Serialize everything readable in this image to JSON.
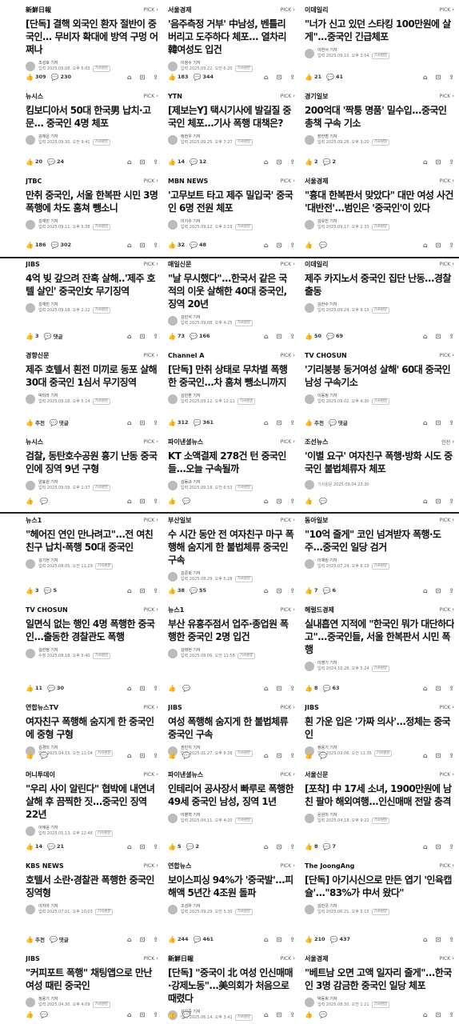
{
  "cards": [
    {
      "press": "新鮮日報",
      "pick": "PICK",
      "title": "[단독] 결핵 외국인 환자 절반이 중국인... 무비자 확대에 방역 구멍 어쩌나",
      "author": "조성호 기자",
      "date": "입력 2025.09.08. 오후 6:03",
      "tag": "기사원문",
      "likes": "309",
      "comments": "230"
    },
    {
      "press": "서울경제",
      "pick": "PICK",
      "title": "'음주측정 거부' 中남성, 벤틀리 버리고 도주하다 체포... 열차리 韓여성도 입건",
      "author": "이정수 기자",
      "date": "입력 2025.09.22. 오전 6:20",
      "tag": "기사원문",
      "likes": "183",
      "comments": "344"
    },
    {
      "press": "이데일리",
      "pick": "PICK",
      "title": "\"너가 신고 있던 스타킹 100만원에 살게\"...중국인 긴급체포",
      "author": "이연서 기자",
      "date": "입력 2025.09.10. 오후 3:54",
      "tag": "기사원문",
      "likes": "21",
      "comments": "41"
    },
    {
      "press": "뉴시스",
      "pick": "PICK",
      "title": "킴보디아서 50대 한국男 납치·고문... 중국인 4명 체포",
      "author": "김재은 기자",
      "date": "입력 2025.09.30. 오전 9:41",
      "tag": "기사원문",
      "likes": "20",
      "comments": "24"
    },
    {
      "press": "YTN",
      "pick": "PICK",
      "title": "[제보는Y] 택시기사에 발길질 중국인 체포...기사 폭행 대책은?",
      "author": "정현우 기자",
      "date": "입력 2025.09.25. 오후 7:27",
      "tag": "기사원문",
      "likes": "14",
      "comments": "12"
    },
    {
      "press": "경기일보",
      "pick": "PICK",
      "title": "200억대 '짝퉁 명품' 밀수입...중국인 총책 구속 기소",
      "author": "장한범 기자",
      "date": "입력 2025.09.28. 오후 3:20",
      "tag": "기사원문",
      "likes": "2",
      "comments": "2"
    },
    {
      "press": "JTBC",
      "pick": "PICK",
      "title": "만취 중국인, 서울 한복판 시민 3명 폭행에 차도 훔쳐 뺑소니",
      "author": "김재민 기자",
      "date": "입력 2025.09.11. 오후 5:38",
      "tag": "기사원문",
      "likes": "186",
      "comments": "302"
    },
    {
      "press": "MBN NEWS",
      "pick": "PICK",
      "title": "'고무보트 타고 제주 밀입국' 중국인 6명 전원 체포",
      "author": "이기수 기자",
      "date": "입력 2025.09.12. 오후 3:19",
      "tag": "기사원문",
      "likes": "32",
      "comments": "48"
    },
    {
      "press": "서울경제",
      "pick": "PICK",
      "title": "\"흉대 한복판서 맞았다\" 대만 여성 사건 '대반전'...범인은 '중국인'이 있다",
      "author": "김유진 기자",
      "date": "입력 2025.09.17. 오후 2:33",
      "tag": "기사원문",
      "likes": "",
      "comments": ""
    },
    {
      "press": "JIBS",
      "pick": "PICK",
      "title": "4억 빚 갚으려 잔혹 살해..'제주 호텔 살인' 중국인女 무기징역",
      "author": "김재진 기자",
      "date": "입력 2025.09.18. 오후 2:22",
      "tag": "기사원문",
      "likes": "3",
      "comments": "댓글"
    },
    {
      "press": "매일신문",
      "pick": "PICK",
      "title": "\"날 무시했다\"...한국서 같은 국적의 이웃 살해한 40대 중국인, 징역 20년",
      "author": "김민석 기자",
      "date": "입력 2025.09.08. 오후 4:25",
      "tag": "기사원문",
      "likes": "73",
      "comments": "166"
    },
    {
      "press": "이데일리",
      "pick": "PICK",
      "title": "제주 카지노서 중국인 집단 난동...경찰 출동",
      "author": "김한수 기자",
      "date": "입력 2025.09.24. 오후 9:13",
      "tag": "기사원문",
      "likes": "50",
      "comments": "69"
    },
    {
      "press": "경향신문",
      "pick": "PICK",
      "title": "제주 호텔서 흰전 미끼로 동포 살해 30대 중국인 1심서 무기징역",
      "author": "박미라 기자",
      "date": "입력 2025.09.18. 오후 5:14",
      "tag": "기사원문",
      "likes": "추천",
      "comments": "댓글"
    },
    {
      "press": "Channel A",
      "pick": "PICK",
      "title": "[단독] 만취 상태로 무차별 폭행한 중국인...차 훔쳐 뺑소니까지",
      "author": "김민환 기자",
      "date": "입력 2025.09.12. 오후 12:11",
      "tag": "기사원문",
      "likes": "312",
      "comments": "361"
    },
    {
      "press": "TV CHOSUN",
      "pick": "PICK",
      "title": "'기리붕붕 동거여성 살해' 60대 중국인 남성 구속기소",
      "author": "이동정 기자",
      "date": "입력 2025.09.02. 오후 4:30",
      "tag": "기사원문",
      "likes": "추천",
      "comments": "댓글"
    },
    {
      "press": "뉴시스",
      "pick": "PICK",
      "title": "검찰, 동탄호수공원 흉기 난동 중국인에 징역 9년 구형",
      "author": "양효원 기자",
      "date": "입력 2025.09.09. 오후 1:37",
      "tag": "기사원문",
      "likes": "",
      "comments": ""
    },
    {
      "press": "파이낸셜뉴스",
      "pick": "PICK",
      "title": "KT 소액결제 278건 턴 중국인들...오늘 구속될까",
      "author": "김동규 기자",
      "date": "입력 2025.09.18. 오전 6:53",
      "tag": "기사원문",
      "likes": "",
      "comments": ""
    },
    {
      "press": "조선뉴스",
      "pick": "인천",
      "title": "'이별 요구' 여자친구 폭행·방화 시도 중국인 불법체류자 체포",
      "author": "",
      "date": "기사원문 2025.09.04 23:30",
      "tag": "",
      "likes": "",
      "comments": ""
    },
    {
      "press": "뉴스1",
      "pick": "PICK",
      "title": "\"헤어진 연인 만나려고\"...전 여친 친구 납치·폭행 50대 중국인",
      "author": "김기현 기자",
      "date": "입력 2025.08.05. 오전 11:29",
      "tag": "기사원문",
      "likes": "3",
      "comments": "5"
    },
    {
      "press": "부산일보",
      "pick": "PICK",
      "title": "수 시간 동안 전 여자친구 마구 폭행해 숨지게 한 불법체류 중국인 구속",
      "author": "김준희 기자",
      "date": "입력 2025.08.29. 오후 5:28",
      "tag": "기사원문",
      "likes": "38",
      "comments": "55"
    },
    {
      "press": "동아일보",
      "pick": "PICK",
      "title": "\"10억 줄게\" 코인 넘겨받자 폭행·도주...중국인 일당 검거",
      "author": "이채린 기자",
      "date": "입력 2025.07.24. 오후 6:19",
      "tag": "기사원문",
      "likes": "7",
      "comments": "6"
    },
    {
      "press": "TV CHOSUN",
      "pick": "PICK",
      "title": "일면식 없는 행인 4명 폭행한 중국인...출동한 경찰관도 폭행",
      "author": "김한정 기자",
      "date": "수정 2025.08.18. 오후 5:40",
      "tag": "기사원문",
      "likes": "11",
      "comments": "30"
    },
    {
      "press": "뉴스1",
      "pick": "PICK",
      "title": "부산 유흥주점서 업주·종업원 폭행한 중국인 2명 입건",
      "author": "김태현 기자",
      "date": "입력 2025.08.06. 오전 11:58",
      "tag": "기사원문",
      "likes": "",
      "comments": ""
    },
    {
      "press": "헤럴드경제",
      "pick": "PICK",
      "title": "실내흡연 지적에 \"한국인 뭐가 대단하다고\"...중국인들, 서울 한복판서 시민 폭행",
      "author": "이영기 기자",
      "date": "입력 2024.10.28. 오후 5:24",
      "tag": "기사원문",
      "likes": "8",
      "comments": "63"
    },
    {
      "press": "연합뉴스TV",
      "pick": "PICK",
      "title": "여자친구 폭행해 숨지게 한 중국인에 중형 구형",
      "author": "김경미 기자",
      "date": "입력 2025.04.15. 오전 11:04",
      "tag": "기사원문",
      "likes": "",
      "comments": ""
    },
    {
      "press": "JIBS",
      "pick": "PICK",
      "title": "여성 폭행해 숨지게 한 불법체류 중국인 구속",
      "author": "권민지 기자",
      "date": "입력 2025.01.27. 오후 8:38",
      "tag": "기사원문",
      "likes": "",
      "comments": ""
    },
    {
      "press": "JIBS",
      "pick": "PICK",
      "title": "흰 가운 입은 '가짜 의사'...정체는 중국인",
      "author": "정용기 기자",
      "date": "입력 2025.03.06. 오전 11:35",
      "tag": "기사원문",
      "likes": "",
      "comments": ""
    },
    {
      "press": "머니투데이",
      "pick": "PICK",
      "title": "\"우리 사이 알린다\" 협박에 내연녀 살해 후 끔찍한 짓...중국인 징역 22년",
      "author": "이재윤 기자",
      "date": "입력 2025.05.13. 오후 12:48",
      "tag": "기사원문",
      "likes": "14",
      "comments": "21"
    },
    {
      "press": "파이낸셜뉴스",
      "pick": "PICK",
      "title": "인테리어 공사장서 빠루로 폭행한 49세 중국인 남성, 징역 1년",
      "author": "이병혁 기자",
      "date": "입력 2025.04.11. 오후 4:20",
      "tag": "기사원문",
      "likes": "5",
      "comments": "2"
    },
    {
      "press": "서울신문",
      "pick": "PICK",
      "title": "[포착] 中 17세 소녀, 1900만원에 남친 팔아 해외여행...인신매매 전말 충격",
      "author": "윤원미 기자",
      "date": "입력 2025.04.18. 오후 9:22",
      "tag": "기사원문",
      "likes": "8",
      "comments": "7"
    },
    {
      "press": "KBS NEWS",
      "pick": "PICK",
      "title": "호텔서 소란·경찰관 폭행한 중국인 징역형",
      "author": "이지아 기자",
      "date": "입력 2025.07.01. 오후 10:03",
      "tag": "기사원문",
      "likes": "추천",
      "comments": "댓글"
    },
    {
      "press": "연합뉴스",
      "pick": "PICK",
      "title": "보이스피싱 94%가 '중국발'...피해액 5년간 4조원 돌파",
      "author": "조성하 기자",
      "date": "입력 2025.09.29. 오전 5:30",
      "tag": "기사원문",
      "likes": "244",
      "comments": "461"
    },
    {
      "press": "The JoongAng",
      "pick": "PICK",
      "title": "[단독] 아기시신으로 만든 엽기 '인육캡슐'...\"83%가 中서 왔다\"",
      "author": "김민국 기자",
      "date": "입력 2025.06.21. 오후 5:15",
      "tag": "기사원문",
      "likes": "210",
      "comments": "437"
    },
    {
      "press": "JIBS",
      "pick": "PICK",
      "title": "\"커피포트 폭행\" 채팅앱으로 만난 여성 때린 중국인",
      "author": "정용기 기자",
      "date": "입력 2025.04.30. 오후 4:09",
      "tag": "기사원문",
      "likes": "",
      "comments": ""
    },
    {
      "press": "新鮮日報",
      "pick": "PICK",
      "title": "[단독] \"중국이 北 여성 인신매매·강제노동\"...美의회가 처음으로 때렸다",
      "author": "김은중 기자",
      "date": "입력 2025.06.14. 오후 3:41",
      "tag": "기사원문",
      "likes": "",
      "comments": ""
    },
    {
      "press": "서울경제",
      "pick": "PICK",
      "title": "\"베트남 오면 고액 일자리 줄게\"...한국인 3명 감금한 중국인 일당 체포",
      "author": "박동휘 기자",
      "date": "입력 2025.08.30. 오전 1:21",
      "tag": "기사원문",
      "likes": "",
      "comments": ""
    }
  ]
}
